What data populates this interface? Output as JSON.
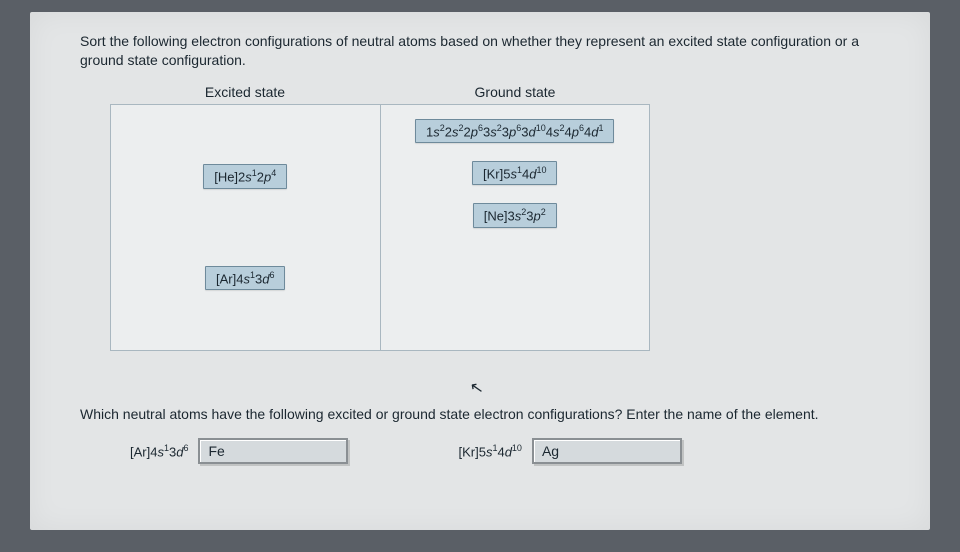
{
  "q1": {
    "prompt": "Sort the following electron configurations of neutral atoms based on whether they represent an excited state configuration or a ground state configuration.",
    "headers": {
      "left": "Excited state",
      "right": "Ground state"
    },
    "excited": [
      {
        "html": "[He]2<span class='italic'>s</span><sup>1</sup>2<span class='italic'>p</span><sup>4</sup>"
      },
      {
        "html": "[Ar]4<span class='italic'>s</span><sup>1</sup>3<span class='italic'>d</span><sup>6</sup>"
      }
    ],
    "ground": [
      {
        "html": "1<span class='italic'>s</span><sup>2</sup>2<span class='italic'>s</span><sup>2</sup>2<span class='italic'>p</span><sup>6</sup>3<span class='italic'>s</span><sup>2</sup>3<span class='italic'>p</span><sup>6</sup>3<span class='italic'>d</span><sup>10</sup>4<span class='italic'>s</span><sup>2</sup>4<span class='italic'>p</span><sup>6</sup>4<span class='italic'>d</span><sup>1</sup>"
      },
      {
        "html": "[Kr]5<span class='italic'>s</span><sup>1</sup>4<span class='italic'>d</span><sup>10</sup>"
      },
      {
        "html": "[Ne]3<span class='italic'>s</span><sup>2</sup>3<span class='italic'>p</span><sup>2</sup>"
      }
    ]
  },
  "q2": {
    "prompt": "Which neutral atoms have the following excited or ground state electron configurations? Enter the name of the element.",
    "items": [
      {
        "config_html": "[Ar]4<span class='italic'>s</span><sup>1</sup>3<span class='italic'>d</span><sup>6</sup>",
        "answer": "Fe"
      },
      {
        "config_html": "[Kr]5<span class='italic'>s</span><sup>1</sup>4<span class='italic'>d</span><sup>10</sup>",
        "answer": "Ag"
      }
    ]
  }
}
